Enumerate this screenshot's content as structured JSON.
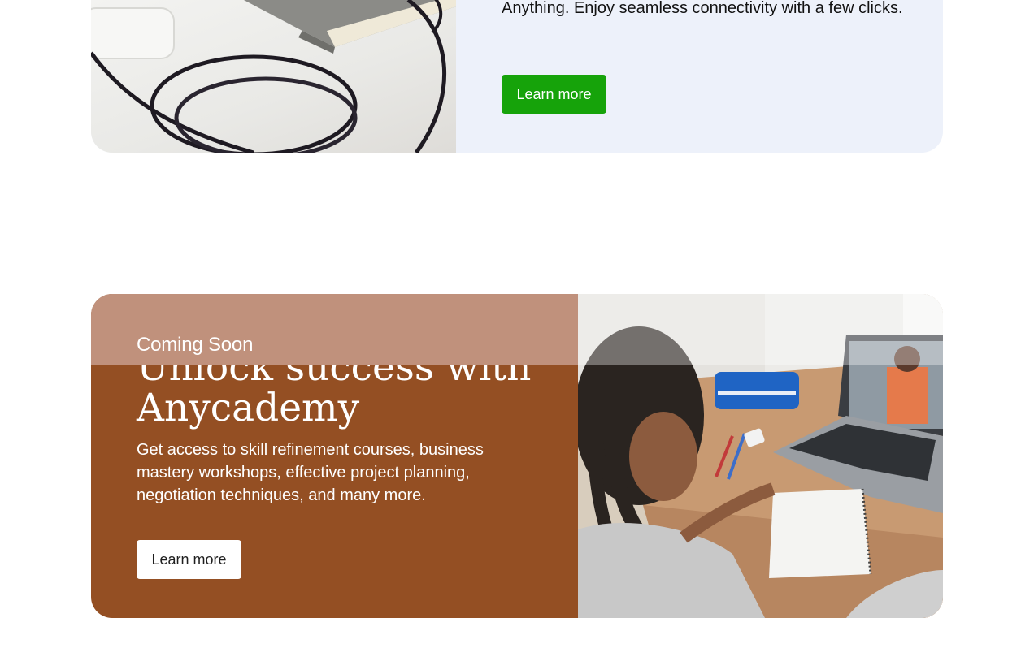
{
  "promo_connectivity": {
    "description": "Anything. Enjoy seamless connectivity with a few clicks.",
    "button_label": "Learn more",
    "button_color": "#16a30a",
    "background_color": "#edf1fa",
    "image": "device-with-cable-photo"
  },
  "promo_anycademy": {
    "badge": "Coming Soon",
    "heading": "Unlock success with Anycademy",
    "description": "Get access to skill refinement courses, business mastery workshops, effective project planning, negotiation techniques, and many more.",
    "button_label": "Learn more",
    "background_color": "#944f23",
    "banner_color": "#c0917c",
    "image": "student-video-call-photo"
  }
}
